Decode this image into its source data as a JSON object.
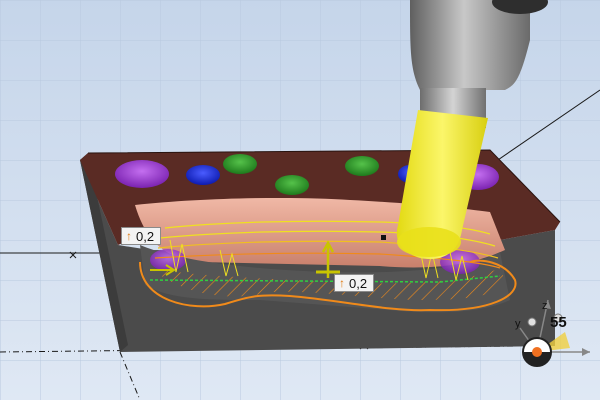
{
  "viewport": {
    "background_top": "#c5d5ea",
    "background_bottom": "#dfe8f4",
    "grid_color": "#b9c9df"
  },
  "part": {
    "top_color": "#5a2b24",
    "side_color": "#4a4a4a",
    "pocket_wall_color": "#e7a38f",
    "hole_colors": [
      "#9b3fd0",
      "#1f2fd6",
      "#2f9a2a"
    ]
  },
  "toolpath": {
    "contour_color": "#f08a1a",
    "pass_color": "#f0e020",
    "link_color": "#30d040"
  },
  "tool": {
    "holder_color": "#8a8a8a",
    "shank_color": "#a0a0a0",
    "cutter_color": "#f2ec2a"
  },
  "dimensions": [
    {
      "icon": "arrow-up-icon",
      "arrow": "↑",
      "value": "0,2"
    },
    {
      "icon": "arrow-up-icon",
      "arrow": "↑",
      "value": "0,2"
    }
  ],
  "triad": {
    "value": "55",
    "y_label": "y",
    "z_label": "z"
  }
}
